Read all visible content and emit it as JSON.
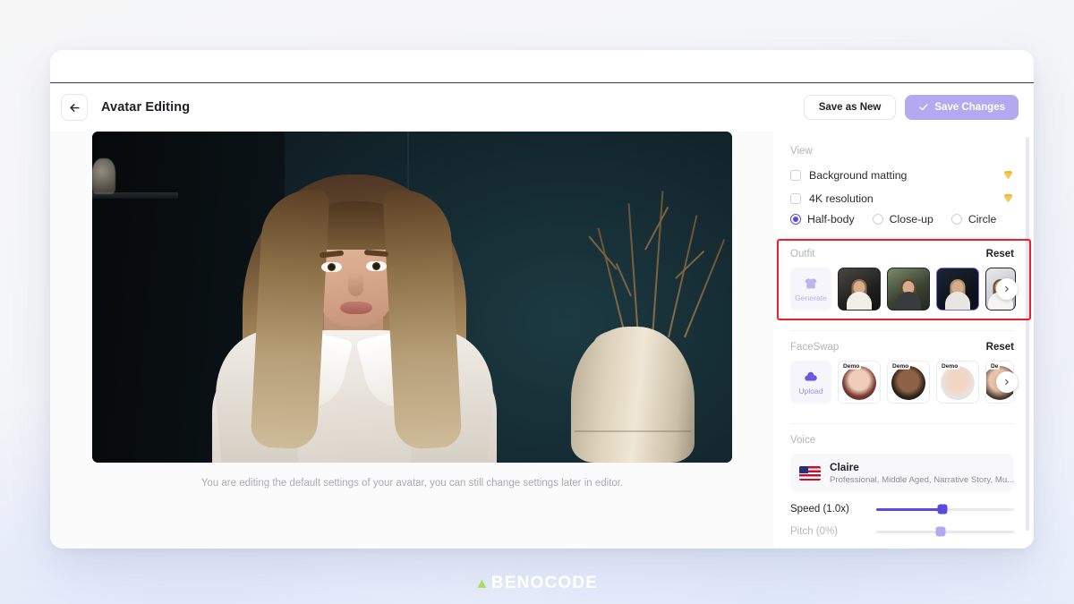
{
  "header": {
    "back_icon": "arrow-left-icon",
    "title": "Avatar Editing",
    "save_as_new_label": "Save as New",
    "save_changes_label": "Save Changes",
    "save_check_icon": "check-icon"
  },
  "preview": {
    "caption": "You are editing the default settings of your avatar, you can still change settings later in editor."
  },
  "sidebar": {
    "view": {
      "label": "View",
      "checkboxes": [
        {
          "label": "Background matting",
          "checked": false,
          "badge_icon": "diamond-icon"
        },
        {
          "label": "4K resolution",
          "checked": false,
          "badge_icon": "diamond-icon"
        }
      ],
      "framing": [
        {
          "label": "Half-body",
          "selected": true
        },
        {
          "label": "Close-up",
          "selected": false
        },
        {
          "label": "Circle",
          "selected": false
        }
      ]
    },
    "outfit": {
      "label": "Outfit",
      "reset_label": "Reset",
      "generate_label": "Generate",
      "generate_icon": "tshirt-icon",
      "next_icon": "chevron-right-icon",
      "items": [
        {
          "selected": false
        },
        {
          "selected": false
        },
        {
          "selected": true
        },
        {
          "selected": false
        }
      ]
    },
    "faceswap": {
      "label": "FaceSwap",
      "reset_label": "Reset",
      "upload_label": "Upload",
      "upload_icon": "cloud-upload-icon",
      "next_icon": "chevron-right-icon",
      "items": [
        {
          "badge": "Demo"
        },
        {
          "badge": "Demo"
        },
        {
          "badge": "Demo"
        },
        {
          "badge": "De"
        }
      ]
    },
    "voice": {
      "label": "Voice",
      "flag_icon": "us-flag-icon",
      "name": "Claire",
      "description": "Professional, Middle Aged, Narrative Story, Mu...",
      "speed_label": "Speed (1.0x)",
      "speed_percent": 48,
      "pitch_label": "Pitch (0%)",
      "pitch_percent": 47
    }
  },
  "watermark": {
    "text": "BENOCODE",
    "mark_icon": "benocode-logo-icon",
    "accent_color": "#a8e05a"
  },
  "colors": {
    "accent_purple": "#5b49e0",
    "primary_button": "#b4a8f0",
    "highlight_red": "#ee1f26",
    "premium_gold": "#f0b429"
  }
}
